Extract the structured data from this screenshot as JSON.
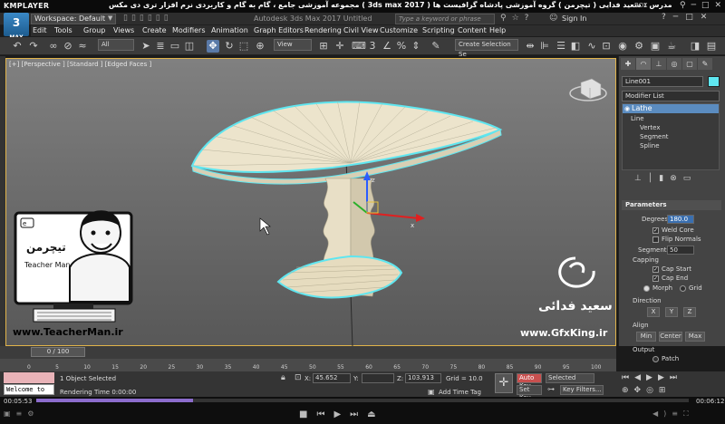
{
  "player": {
    "logo": "KMPLAYER",
    "title": "مجموعه آموزشی جامع ، گام به گام و کاربردی نرم افزار تری دی مکس ( 3ds max 2017 )   مدرس : سعید فدایی ( تیچرمن ) گروه آموزشی پادشاه گرافیست ها",
    "right_label": "BOX",
    "time_current": "00:05:53",
    "time_total": "00:06:12",
    "progress_fraction": 0.24
  },
  "max": {
    "icon_label": "3",
    "icon_sub": "MAX",
    "workspace": "Workspace: Default",
    "app_title": "Autodesk 3ds Max 2017    Untitled",
    "search_placeholder": "Type a keyword or phrase",
    "sign_in": "Sign In",
    "menu": [
      "Edit",
      "Tools",
      "Group",
      "Views",
      "Create",
      "Modifiers",
      "Animation",
      "Graph Editors",
      "Rendering",
      "Civil View",
      "Customize",
      "Scripting",
      "Content",
      "Help"
    ],
    "toolbar": {
      "filter": "All",
      "ref_coord": "View",
      "selection_set": "Create Selection Se"
    }
  },
  "viewport": {
    "label": "[+] [Perspective ] [Standard ] [Edged Faces ]"
  },
  "command_panel": {
    "object_name": "Line001",
    "object_color": "#5fe6f0",
    "modifier_list": "Modifier List",
    "stack": {
      "lathe": "Lathe",
      "line": "Line",
      "vertex": "Vertex",
      "segment": "Segment",
      "spline": "Spline"
    },
    "params_title": "Parameters",
    "degrees_label": "Degrees:",
    "degrees_value": "180.0",
    "weld_core": "Weld Core",
    "flip_normals": "Flip Normals",
    "segments_label": "Segments:",
    "segments_value": "50",
    "capping_label": "Capping",
    "cap_start": "Cap Start",
    "cap_end": "Cap End",
    "morph": "Morph",
    "grid": "Grid",
    "direction_label": "Direction",
    "dir_x": "X",
    "dir_y": "Y",
    "dir_z": "Z",
    "align_label": "Align",
    "align_min": "Min",
    "align_center": "Center",
    "align_max": "Max",
    "output_label": "Output",
    "patch": "Patch"
  },
  "timeline": {
    "slider": "0 / 100",
    "ticks": [
      "0",
      "5",
      "10",
      "15",
      "20",
      "25",
      "30",
      "35",
      "40",
      "45",
      "50",
      "55",
      "60",
      "65",
      "70",
      "75",
      "80",
      "85",
      "90",
      "95",
      "100"
    ]
  },
  "status": {
    "welcome": "Welcome to M.",
    "selected": "1 Object Selected",
    "render_time": "Rendering Time  0:00:00",
    "x_label": "X:",
    "x_value": "45.652",
    "y_label": "Y:",
    "y_value": "",
    "z_label": "Z:",
    "z_value": "103.913",
    "grid": "Grid = 10.0",
    "add_time_tag": "Add Time Tag",
    "auto_key": "Auto Key",
    "selected_dd": "Selected",
    "set_key": "Set Key",
    "key_filters": "Key Filters..."
  },
  "watermark": {
    "teacher_url": "www.TeacherMan.ir",
    "teacher_name": "Teacher Man",
    "teacher_logo": "تیچرمن",
    "gfx_url": "www.GfxKing.ir",
    "gfx_name": "سعید فدائی"
  }
}
